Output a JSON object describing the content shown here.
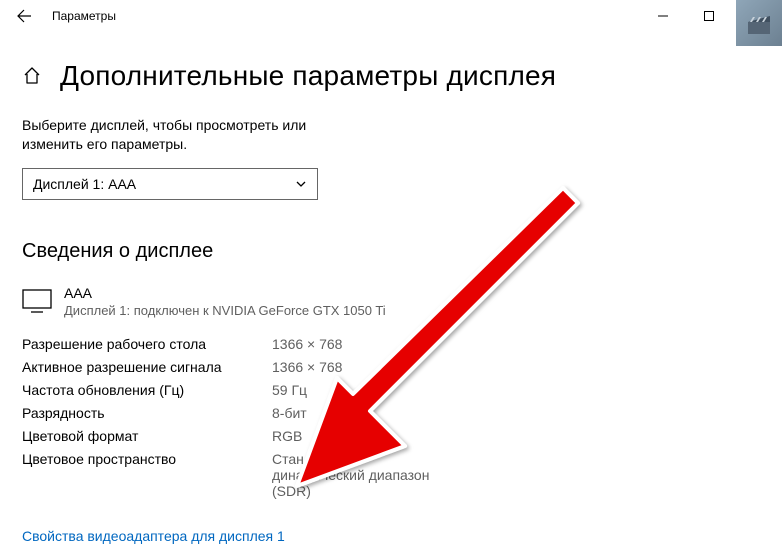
{
  "titlebar": {
    "title": "Параметры"
  },
  "header": {
    "title": "Дополнительные параметры дисплея"
  },
  "instruction": "Выберите дисплей, чтобы просмотреть или изменить его параметры.",
  "display_select": {
    "value": "Дисплей 1: AAA"
  },
  "section_title": "Сведения о дисплее",
  "display_info": {
    "name": "AAA",
    "subtitle": "Дисплей 1: подключен к NVIDIA GeForce GTX 1050 Ti"
  },
  "info_rows": [
    {
      "label": "Разрешение рабочего стола",
      "value": "1366 × 768"
    },
    {
      "label": "Активное разрешение сигнала",
      "value": "1366 × 768"
    },
    {
      "label": "Частота обновления (Гц)",
      "value": "59 Гц"
    },
    {
      "label": "Разрядность",
      "value": "8-бит"
    },
    {
      "label": "Цветовой формат",
      "value": "RGB"
    },
    {
      "label": "Цветовое пространство",
      "value": "Стандартный динамический диапазон (SDR)"
    }
  ],
  "link": "Свойства видеоадаптера для дисплея 1"
}
